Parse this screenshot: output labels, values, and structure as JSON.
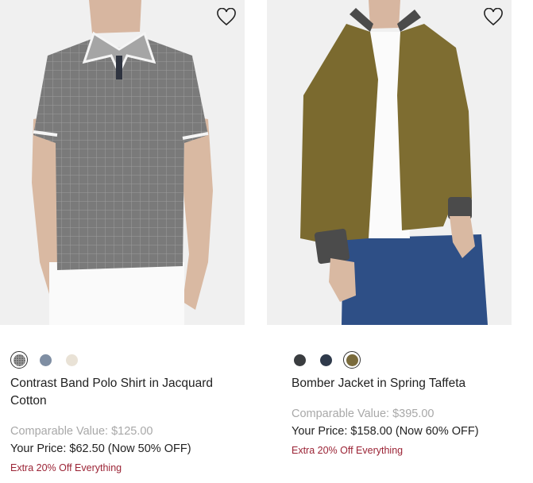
{
  "products": [
    {
      "name": "Contrast Band Polo Shirt in Jacquard Cotton",
      "comparable_value": "Comparable Value: $125.00",
      "your_price": "Your Price: $62.50 (Now 50% OFF)",
      "promo": "Extra 20% Off Everything",
      "image_icon": "polo-shirt-photo",
      "swatches": [
        {
          "name": "gray-jacquard",
          "color": "#6e6e6e",
          "selected": true
        },
        {
          "name": "blue-gray",
          "color": "#7f8ea3",
          "selected": false
        },
        {
          "name": "cream",
          "color": "#e9e2d6",
          "selected": false
        }
      ]
    },
    {
      "name": "Bomber Jacket in Spring Taffeta",
      "comparable_value": "Comparable Value: $395.00",
      "your_price": "Your Price: $158.00 (Now 60% OFF)",
      "promo": "Extra 20% Off Everything",
      "image_icon": "bomber-jacket-photo",
      "swatches": [
        {
          "name": "charcoal",
          "color": "#3a3d40",
          "selected": false
        },
        {
          "name": "navy",
          "color": "#2f3a4b",
          "selected": false
        },
        {
          "name": "olive",
          "color": "#7a6b3c",
          "selected": true
        }
      ]
    }
  ],
  "colors": {
    "promo": "#9b2335",
    "comparable": "#a8a8a8",
    "image_bg": "#f0f0f0"
  }
}
